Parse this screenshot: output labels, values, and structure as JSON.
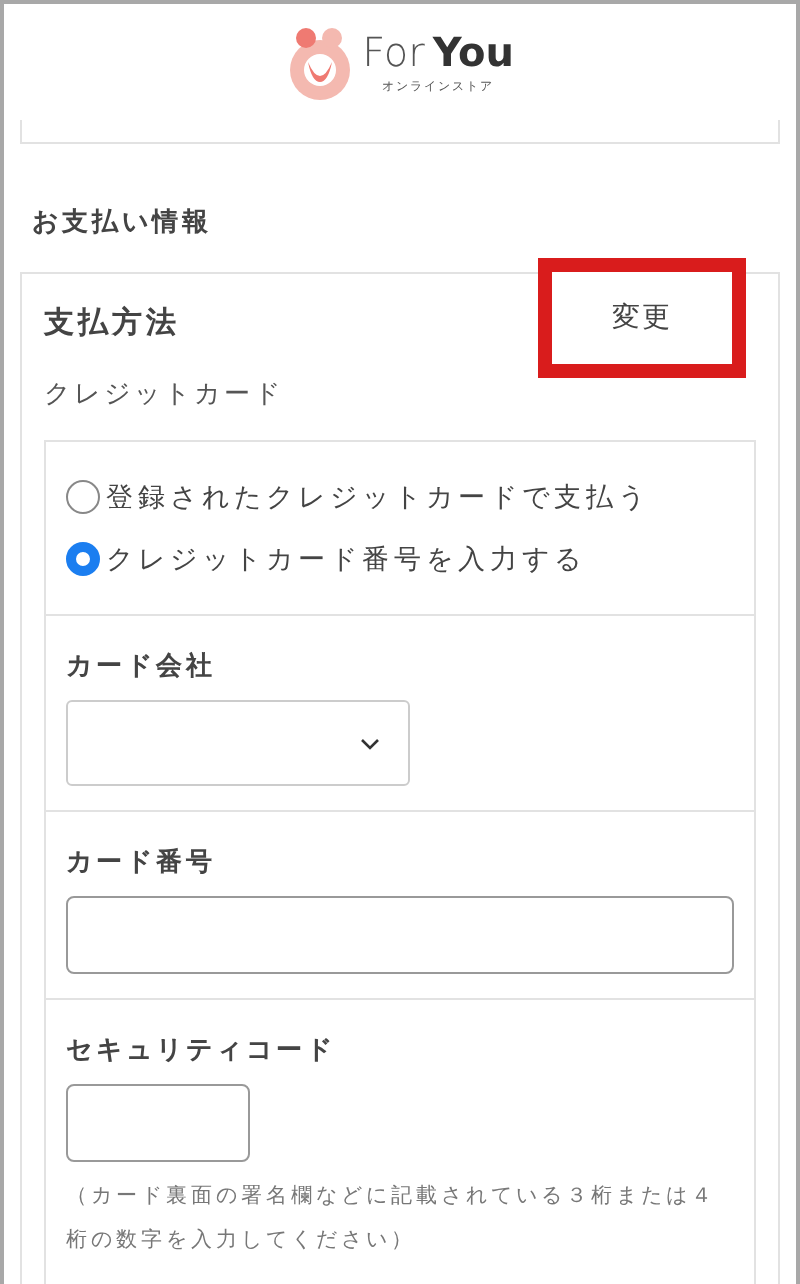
{
  "brand": {
    "word1": "For",
    "word2": "You",
    "tagline": "オンラインストア"
  },
  "section_title": "お支払い情報",
  "payment": {
    "title": "支払方法",
    "change_button": "変更",
    "method": "クレジットカード",
    "options": [
      {
        "label": "登録されたクレジットカードで支払う",
        "selected": false
      },
      {
        "label": "クレジットカード番号を入力する",
        "selected": true
      }
    ],
    "fields": [
      {
        "kind": "select",
        "label": "カード会社"
      },
      {
        "kind": "text",
        "label": "カード番号"
      },
      {
        "kind": "short",
        "label": "セキュリティコード",
        "note": "（カード裏面の署名欄などに記載されている３桁または４桁の数字を入力してください）"
      }
    ]
  }
}
